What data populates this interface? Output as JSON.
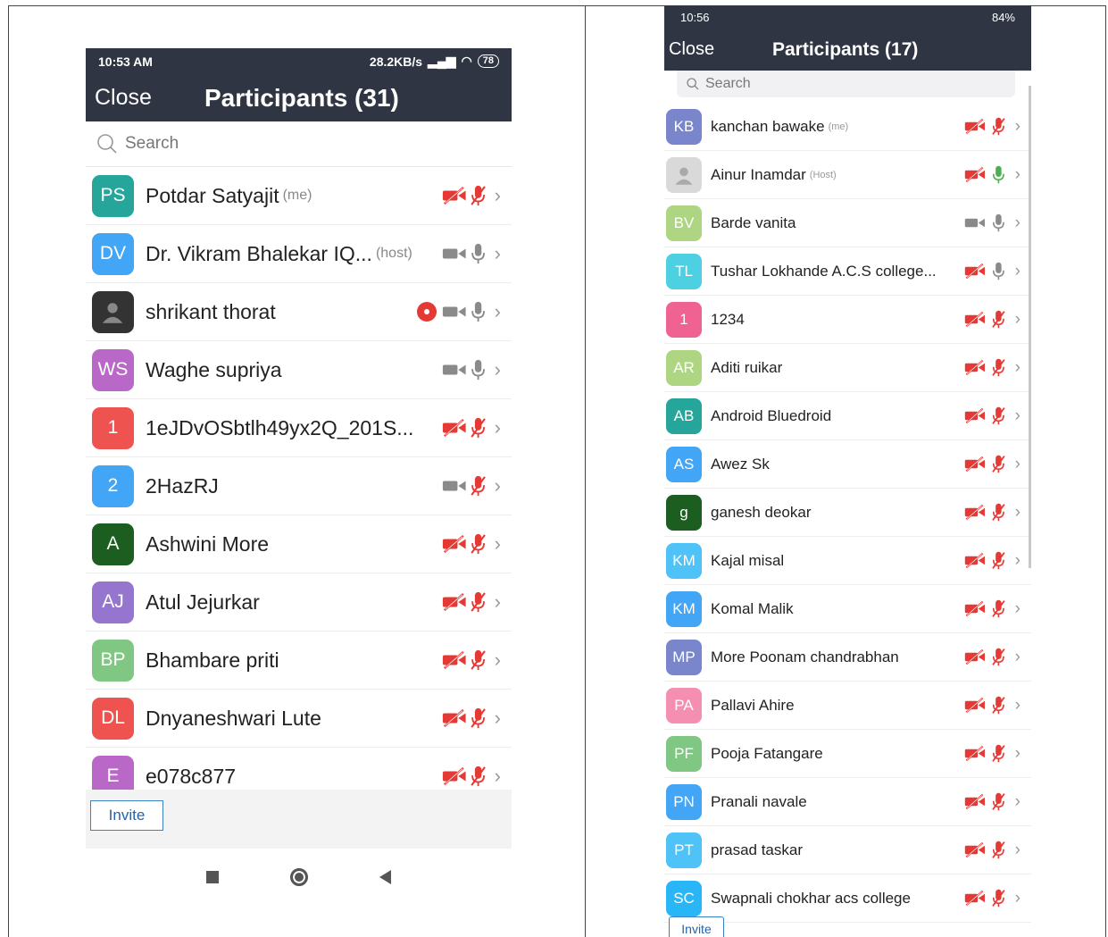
{
  "colors": {
    "header_bg": "#2f3542",
    "muted_red": "#e53935",
    "gray_icon": "#8a8a8a",
    "mic_green": "#4caf50",
    "invite_blue": "#2563a8"
  },
  "left": {
    "status": {
      "time": "10:53 AM",
      "speed": "28.2KB/s",
      "battery": "78"
    },
    "header": {
      "close": "Close",
      "title": "Participants (31)"
    },
    "search_placeholder": "Search",
    "participants": [
      {
        "initials": "PS",
        "color": "#26a69a",
        "name": "Potdar Satyajit",
        "tag": "(me)",
        "video": "off",
        "mic": "muted"
      },
      {
        "initials": "DV",
        "color": "#42a5f5",
        "name": "Dr. Vikram Bhalekar IQ...",
        "tag": "(host)",
        "video": "on",
        "mic": "on"
      },
      {
        "initials": "",
        "color": "#333333",
        "name": "shrikant thorat",
        "tag": "",
        "video": "on",
        "mic": "on",
        "recording": true
      },
      {
        "initials": "WS",
        "color": "#ba68c8",
        "name": "Waghe supriya",
        "tag": "",
        "video": "on",
        "mic": "on"
      },
      {
        "initials": "1",
        "color": "#ef5350",
        "name": "1eJDvOSbtlh49yx2Q_201S...",
        "tag": "",
        "video": "off",
        "mic": "muted"
      },
      {
        "initials": "2",
        "color": "#42a5f5",
        "name": "2HazRJ",
        "tag": "",
        "video": "on",
        "mic": "muted"
      },
      {
        "initials": "A",
        "color": "#1b5e20",
        "name": "Ashwini More",
        "tag": "",
        "video": "off",
        "mic": "muted"
      },
      {
        "initials": "AJ",
        "color": "#9575cd",
        "name": "Atul Jejurkar",
        "tag": "",
        "video": "off",
        "mic": "muted"
      },
      {
        "initials": "BP",
        "color": "#81c784",
        "name": "Bhambare priti",
        "tag": "",
        "video": "off",
        "mic": "muted"
      },
      {
        "initials": "DL",
        "color": "#ef5350",
        "name": "Dnyaneshwari Lute",
        "tag": "",
        "video": "off",
        "mic": "muted"
      },
      {
        "initials": "E",
        "color": "#ba68c8",
        "name": "e078c877",
        "tag": "",
        "video": "off",
        "mic": "muted"
      }
    ],
    "invite": "Invite"
  },
  "right": {
    "status": {
      "time": "10:56",
      "battery": "84%"
    },
    "header": {
      "close": "Close",
      "title": "Participants (17)"
    },
    "search_placeholder": "Search",
    "participants": [
      {
        "initials": "KB",
        "color": "#7986cb",
        "name": "kanchan bawake",
        "tag": "(me)",
        "video": "off",
        "mic": "muted"
      },
      {
        "initials": "",
        "color": "#d9d9d9",
        "name": "Ainur Inamdar",
        "tag": "(Host)",
        "video": "off",
        "mic": "active"
      },
      {
        "initials": "BV",
        "color": "#aed581",
        "name": "Barde vanita",
        "tag": "",
        "video": "on",
        "mic": "on"
      },
      {
        "initials": "TL",
        "color": "#4dd0e1",
        "name": "Tushar Lokhande A.C.S college...",
        "tag": "",
        "video": "off",
        "mic": "on"
      },
      {
        "initials": "1",
        "color": "#f06292",
        "name": "1234",
        "tag": "",
        "video": "off",
        "mic": "muted"
      },
      {
        "initials": "AR",
        "color": "#aed581",
        "name": "Aditi ruikar",
        "tag": "",
        "video": "off",
        "mic": "muted"
      },
      {
        "initials": "AB",
        "color": "#26a69a",
        "name": "Android Bluedroid",
        "tag": "",
        "video": "off",
        "mic": "muted"
      },
      {
        "initials": "AS",
        "color": "#42a5f5",
        "name": "Awez Sk",
        "tag": "",
        "video": "off",
        "mic": "muted"
      },
      {
        "initials": "g",
        "color": "#1b5e20",
        "name": "ganesh deokar",
        "tag": "",
        "video": "off",
        "mic": "muted"
      },
      {
        "initials": "KM",
        "color": "#4fc3f7",
        "name": "Kajal misal",
        "tag": "",
        "video": "off",
        "mic": "muted"
      },
      {
        "initials": "KM",
        "color": "#42a5f5",
        "name": "Komal Malik",
        "tag": "",
        "video": "off",
        "mic": "muted"
      },
      {
        "initials": "MP",
        "color": "#7986cb",
        "name": "More Poonam chandrabhan",
        "tag": "",
        "video": "off",
        "mic": "muted"
      },
      {
        "initials": "PA",
        "color": "#f48fb1",
        "name": "Pallavi Ahire",
        "tag": "",
        "video": "off",
        "mic": "muted"
      },
      {
        "initials": "PF",
        "color": "#81c784",
        "name": "Pooja Fatangare",
        "tag": "",
        "video": "off",
        "mic": "muted"
      },
      {
        "initials": "PN",
        "color": "#42a5f5",
        "name": "Pranali navale",
        "tag": "",
        "video": "off",
        "mic": "muted"
      },
      {
        "initials": "PT",
        "color": "#4fc3f7",
        "name": "prasad taskar",
        "tag": "",
        "video": "off",
        "mic": "muted"
      },
      {
        "initials": "SC",
        "color": "#29b6f6",
        "name": "Swapnali chokhar acs college",
        "tag": "",
        "video": "off",
        "mic": "muted"
      }
    ],
    "invite": "Invite"
  }
}
